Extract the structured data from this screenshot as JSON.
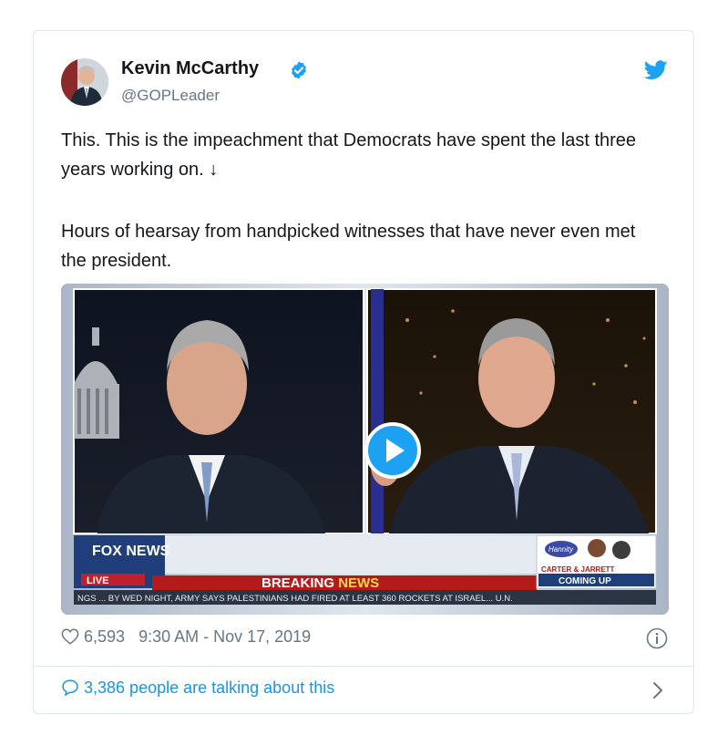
{
  "author": {
    "name": "Kevin McCarthy",
    "handle": "@GOPLeader"
  },
  "tweet": {
    "paragraph1": "This. This is the impeachment that Democrats have spent the last three years working on. ↓",
    "paragraph2": "Hours of hearsay from handpicked witnesses that have never even met the president."
  },
  "video": {
    "network_logo": "FOX NEWS",
    "live_label": "LIVE",
    "breaking_label_1": "BREAKING",
    "breaking_label_2": "NEWS",
    "ticker": "NGS ... BY WED NIGHT, ARMY SAYS PALESTINIANS HAD FIRED AT LEAST 360 ROCKETS AT ISRAEL... U.N.",
    "promo_show": "Hannity",
    "promo_title": "CARTER & JARRETT",
    "promo_subtitle": "COMING UP"
  },
  "stats": {
    "likes": "6,593",
    "timestamp": "9:30 AM - Nov 17, 2019"
  },
  "footer": {
    "talking": "3,386 people are talking about this"
  },
  "colors": {
    "accent": "#1da1f2",
    "link": "#1b95e0",
    "muted": "#657786"
  },
  "icons": {
    "verified": "verified-badge-icon",
    "platform": "twitter-bird-icon",
    "play": "play-icon",
    "like": "heart-icon",
    "info": "info-icon",
    "reply": "speech-bubble-icon",
    "chevron": "chevron-right-icon"
  }
}
